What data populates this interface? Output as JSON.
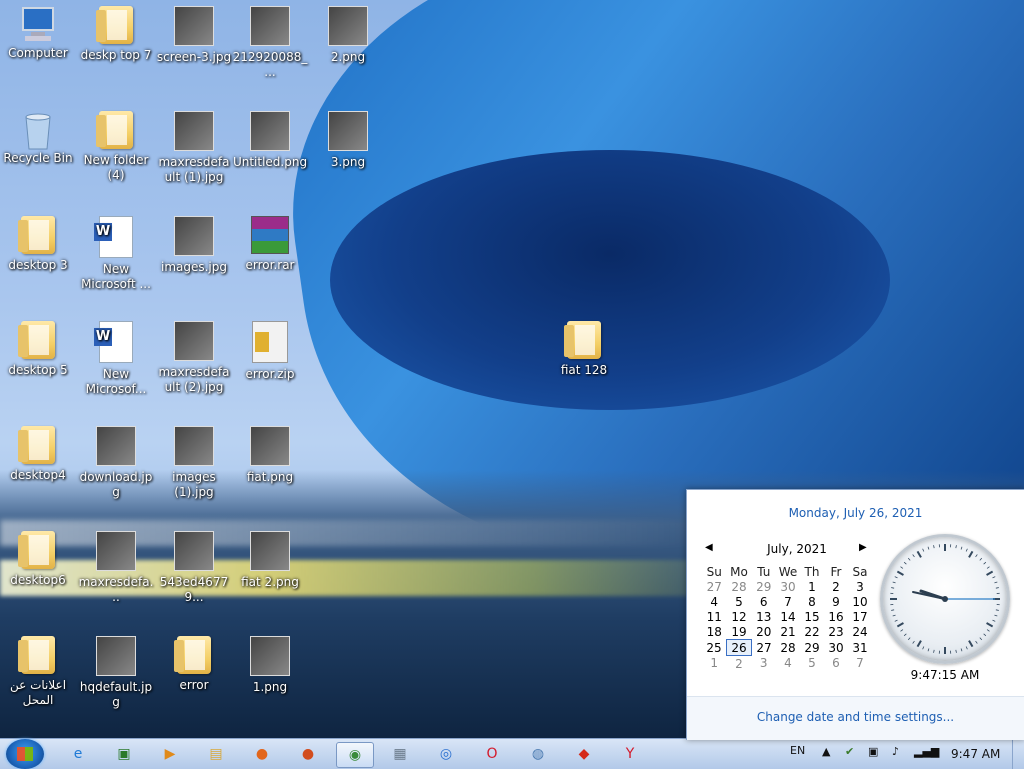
{
  "desktop_icons": [
    {
      "label": "Computer",
      "type": "sys"
    },
    {
      "label": "deskp top 7",
      "type": "folder"
    },
    {
      "label": "screen-3.jpg",
      "type": "photo"
    },
    {
      "label": "212920088_...",
      "type": "photo"
    },
    {
      "label": "2.png",
      "type": "photo"
    },
    {
      "label": "Recycle Bin",
      "type": "sys"
    },
    {
      "label": "New folder (4)",
      "type": "folder"
    },
    {
      "label": "maxresdefault (1).jpg",
      "type": "photo"
    },
    {
      "label": "Untitled.png",
      "type": "photo"
    },
    {
      "label": "3.png",
      "type": "photo"
    },
    {
      "label": "desktop 3",
      "type": "folder"
    },
    {
      "label": "New Microsoft ...",
      "type": "doc"
    },
    {
      "label": "images.jpg",
      "type": "photo"
    },
    {
      "label": "error.rar",
      "type": "archive"
    },
    {
      "label": "desktop 5",
      "type": "folder"
    },
    {
      "label": "New Microsof...",
      "type": "doc"
    },
    {
      "label": "maxresdefault (2).jpg",
      "type": "photo"
    },
    {
      "label": "error.zip",
      "type": "zip"
    },
    {
      "label": "desktop4",
      "type": "folder"
    },
    {
      "label": "download.jpg",
      "type": "photo"
    },
    {
      "label": "images (1).jpg",
      "type": "photo"
    },
    {
      "label": "fiat.png",
      "type": "photo"
    },
    {
      "label": "desktop6",
      "type": "folder"
    },
    {
      "label": "maxresdefa...",
      "type": "photo"
    },
    {
      "label": "543ed46779...",
      "type": "photo"
    },
    {
      "label": "fiat 2.png",
      "type": "photo"
    },
    {
      "label": "اعلانات عن المحل",
      "type": "folder"
    },
    {
      "label": "hqdefault.jpg",
      "type": "photo"
    },
    {
      "label": "error",
      "type": "folder"
    },
    {
      "label": "1.png",
      "type": "photo"
    },
    {
      "label": "fiat 128",
      "type": "folder"
    }
  ],
  "taskbar": {
    "apps": [
      {
        "name": "internet-explorer-icon",
        "glyph": "e",
        "color": "#1e7ad6"
      },
      {
        "name": "terminal-icon",
        "glyph": "▣",
        "color": "#2a7a2a"
      },
      {
        "name": "media-player-icon",
        "glyph": "▶",
        "color": "#e08a1a"
      },
      {
        "name": "file-explorer-icon",
        "glyph": "▤",
        "color": "#d8a93a"
      },
      {
        "name": "firefox-icon",
        "glyph": "●",
        "color": "#e2661c"
      },
      {
        "name": "firefox-alt-icon",
        "glyph": "●",
        "color": "#d24d1e"
      },
      {
        "name": "chrome-icon",
        "glyph": "◉",
        "color": "#3a8a3a"
      },
      {
        "name": "calculator-icon",
        "glyph": "▦",
        "color": "#6a7a8a"
      },
      {
        "name": "chrome-blue-icon",
        "glyph": "◎",
        "color": "#2a6fd0"
      },
      {
        "name": "opera-icon",
        "glyph": "O",
        "color": "#d4192a"
      },
      {
        "name": "network-app-icon",
        "glyph": "◍",
        "color": "#4a7ab0"
      },
      {
        "name": "superman-icon",
        "glyph": "◆",
        "color": "#d42a1a"
      },
      {
        "name": "yandex-icon",
        "glyph": "Y",
        "color": "#d4192a"
      }
    ],
    "lang": "EN",
    "time": "9:47 AM"
  },
  "calendar": {
    "long_date": "Monday, July 26, 2021",
    "month_label": "July, 2021",
    "weekdays": [
      "Su",
      "Mo",
      "Tu",
      "We",
      "Th",
      "Fr",
      "Sa"
    ],
    "weeks": [
      [
        "27",
        "28",
        "29",
        "30",
        "1",
        "2",
        "3"
      ],
      [
        "4",
        "5",
        "6",
        "7",
        "8",
        "9",
        "10"
      ],
      [
        "11",
        "12",
        "13",
        "14",
        "15",
        "16",
        "17"
      ],
      [
        "18",
        "19",
        "20",
        "21",
        "22",
        "23",
        "24"
      ],
      [
        "25",
        "26",
        "27",
        "28",
        "29",
        "30",
        "31"
      ],
      [
        "1",
        "2",
        "3",
        "4",
        "5",
        "6",
        "7"
      ]
    ],
    "today": "26",
    "clock_time": "9:47:15 AM",
    "settings_link": "Change date and time settings..."
  }
}
